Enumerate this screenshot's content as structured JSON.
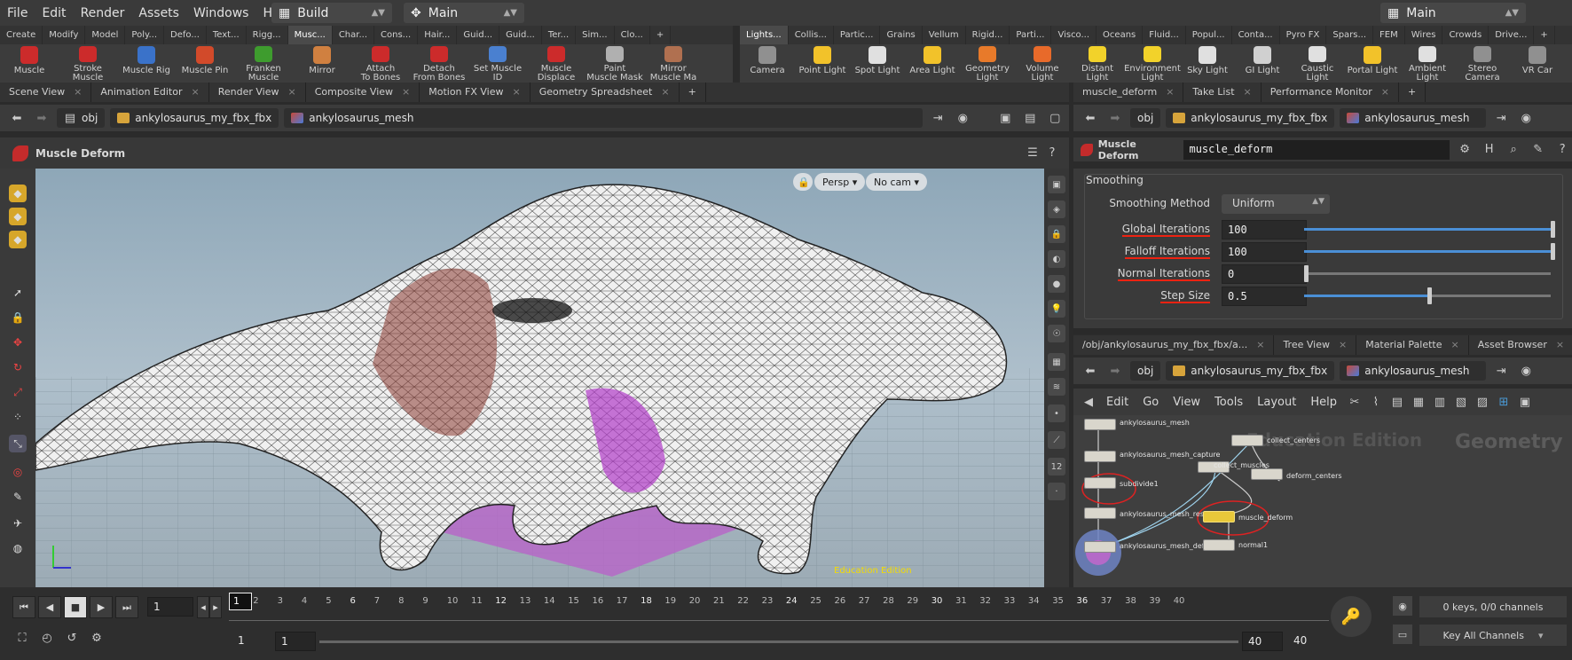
{
  "menubar": {
    "items": [
      "File",
      "Edit",
      "Render",
      "Assets",
      "Windows",
      "Help"
    ],
    "desktop": "Build",
    "context": "Main",
    "right_desktop": "Main"
  },
  "shelf_left": {
    "tabs": [
      "Create",
      "Modify",
      "Model",
      "Poly...",
      "Defo...",
      "Text...",
      "Rigg...",
      "Musc...",
      "Char...",
      "Cons...",
      "Hair...",
      "Guid...",
      "Guid...",
      "Ter...",
      "Sim...",
      "Clo..."
    ],
    "active": "Musc...",
    "tools": [
      {
        "label": "Muscle",
        "color": "#cc2b2b"
      },
      {
        "label": "Stroke Muscle",
        "color": "#cc2b2b"
      },
      {
        "label": "Muscle Rig",
        "color": "#3a72c9"
      },
      {
        "label": "Muscle Pin",
        "color": "#d24a2a"
      },
      {
        "label": "Franken\nMuscle",
        "color": "#3e9c2e"
      },
      {
        "label": "Mirror",
        "color": "#d08040"
      },
      {
        "label": "Attach\nTo Bones",
        "color": "#cc2b2b"
      },
      {
        "label": "Detach\nFrom Bones",
        "color": "#cc2b2b"
      },
      {
        "label": "Set Muscle ID",
        "color": "#4a80d0"
      },
      {
        "label": "Muscle\nDisplace",
        "color": "#cc2b2b"
      },
      {
        "label": "Paint\nMuscle Mask",
        "color": "#b0b0b0"
      },
      {
        "label": "Mirror\nMuscle Ma",
        "color": "#b07050"
      }
    ]
  },
  "shelf_right": {
    "tabs": [
      "Lights...",
      "Collis...",
      "Partic...",
      "Grains",
      "Vellum",
      "Rigid...",
      "Parti...",
      "Visco...",
      "Oceans",
      "Fluid...",
      "Popul...",
      "Conta...",
      "Pyro FX",
      "Spars...",
      "FEM",
      "Wires",
      "Crowds",
      "Drive..."
    ],
    "active": "Lights...",
    "tools": [
      {
        "label": "Camera",
        "color": "#909090"
      },
      {
        "label": "Point Light",
        "color": "#f2c22a"
      },
      {
        "label": "Spot Light",
        "color": "#e0e0e0"
      },
      {
        "label": "Area Light",
        "color": "#f2c22a"
      },
      {
        "label": "Geometry\nLight",
        "color": "#e87a2a"
      },
      {
        "label": "Volume Light",
        "color": "#e86a2a"
      },
      {
        "label": "Distant Light",
        "color": "#f2d22a"
      },
      {
        "label": "Environment\nLight",
        "color": "#f2d22a"
      },
      {
        "label": "Sky Light",
        "color": "#e0e0e0"
      },
      {
        "label": "GI Light",
        "color": "#d0d0d0"
      },
      {
        "label": "Caustic Light",
        "color": "#e0e0e0"
      },
      {
        "label": "Portal Light",
        "color": "#f2c22a"
      },
      {
        "label": "Ambient Light",
        "color": "#e0e0e0"
      },
      {
        "label": "Stereo\nCamera",
        "color": "#909090"
      },
      {
        "label": "VR Car",
        "color": "#909090"
      }
    ]
  },
  "left_panel": {
    "tabs": [
      "Scene View",
      "Animation Editor",
      "Render View",
      "Composite View",
      "Motion FX View",
      "Geometry Spreadsheet"
    ],
    "path": [
      "obj",
      "ankylosaurus_my_fbx_fbx",
      "ankylosaurus_mesh"
    ],
    "title": "Muscle Deform",
    "persp": "Persp",
    "cam": "No cam",
    "watermark": "Education Edition"
  },
  "param_panel": {
    "tabs": [
      "muscle_deform",
      "Take List",
      "Performance Monitor"
    ],
    "path": [
      "obj",
      "ankylosaurus_my_fbx_fbx",
      "ankylosaurus_mesh"
    ],
    "node_type": "Muscle Deform",
    "node_name": "muscle_deform",
    "section": "Smoothing",
    "method_label": "Smoothing Method",
    "method_value": "Uniform",
    "params": [
      {
        "label": "Global Iterations",
        "value": "100",
        "fraction": 1.0,
        "highlight": true
      },
      {
        "label": "Falloff Iterations",
        "value": "100",
        "fraction": 1.0,
        "highlight": true
      },
      {
        "label": "Normal Iterations",
        "value": "0",
        "fraction": 0.0,
        "highlight": true
      },
      {
        "label": "Step Size",
        "value": "0.5",
        "fraction": 0.5,
        "highlight": true
      }
    ]
  },
  "network_panel": {
    "tabs": [
      "/obj/ankylosaurus_my_fbx_fbx/a...",
      "Tree View",
      "Material Palette",
      "Asset Browser"
    ],
    "path": [
      "obj",
      "ankylosaurus_my_fbx_fbx",
      "ankylosaurus_mesh"
    ],
    "menu": [
      "Edit",
      "Go",
      "View",
      "Tools",
      "Layout",
      "Help"
    ],
    "watermark": "Education Edition",
    "context_label": "Geometry",
    "nodes": [
      "ankylosaurus_mesh",
      "ankylosaurus_mesh_capture",
      "subdivide1",
      "ankylosaurus_mesh_rest/ide",
      "ankylosaurus_mesh_deform",
      "collect_centers",
      "collect_muscles",
      "deform_centers",
      "muscle_deform",
      "normal1"
    ]
  },
  "timeline": {
    "ticks": [
      "1",
      "2",
      "3",
      "4",
      "5",
      "6",
      "7",
      "8",
      "9",
      "10",
      "11",
      "12",
      "13",
      "14",
      "15",
      "16",
      "17",
      "18",
      "19",
      "20",
      "21",
      "22",
      "23",
      "24",
      "25",
      "26",
      "27",
      "28",
      "29",
      "30",
      "31",
      "32",
      "33",
      "34",
      "35",
      "36",
      "37",
      "38",
      "39",
      "40"
    ],
    "current_frame": "1",
    "start": "1",
    "range_start": "1",
    "range_end": "40",
    "end": "40",
    "keys": "0 keys, 0/0 channels",
    "key_all": "Key All Channels"
  }
}
